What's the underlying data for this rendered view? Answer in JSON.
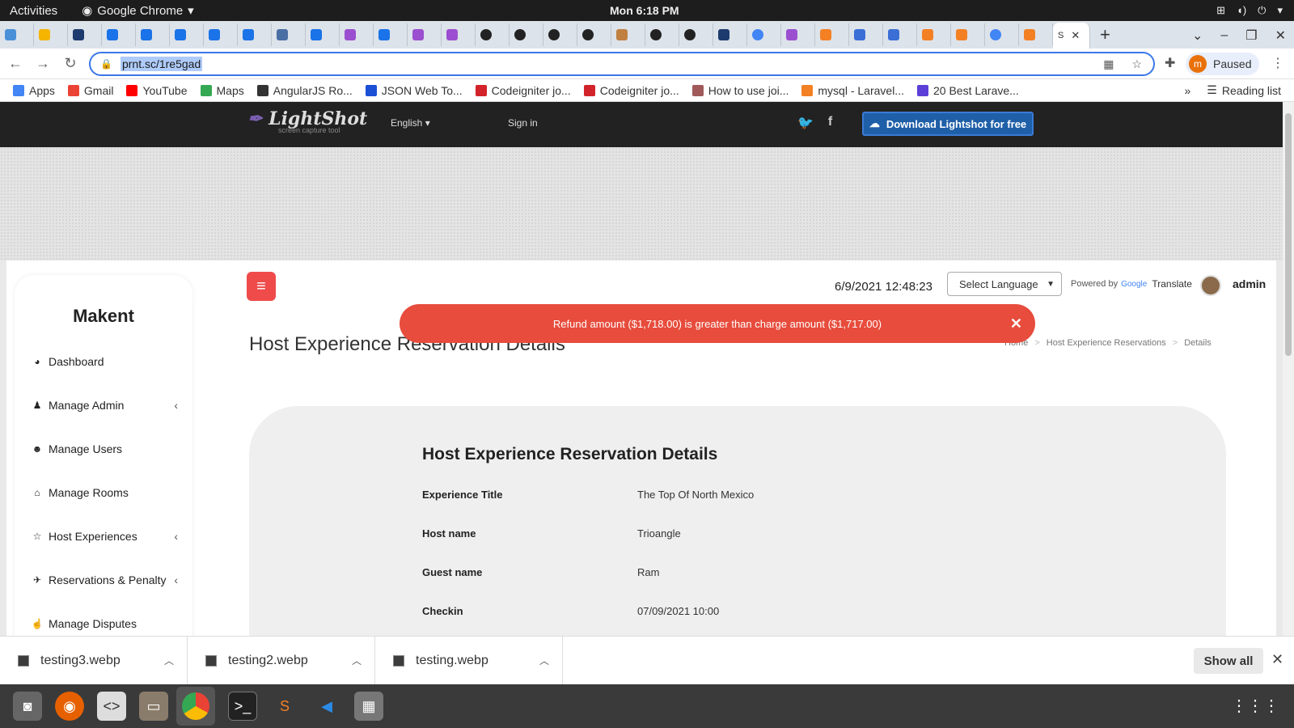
{
  "os": {
    "activities": "Activities",
    "app_name": "Google Chrome",
    "clock": "Mon  6:18 PM"
  },
  "browser": {
    "url": "prnt.sc/1re5gad",
    "profile_initial": "m",
    "profile_status": "Paused",
    "active_tab_label": "S"
  },
  "bookmarks": [
    {
      "label": "Apps",
      "color": "#4285f4"
    },
    {
      "label": "Gmail",
      "color": "#ea4335"
    },
    {
      "label": "YouTube",
      "color": "#ff0000"
    },
    {
      "label": "Maps",
      "color": "#34a853"
    },
    {
      "label": "AngularJS Ro...",
      "color": "#333333"
    },
    {
      "label": "JSON Web To...",
      "color": "#1a4fd6"
    },
    {
      "label": "Codeigniter jo...",
      "color": "#d2232a"
    },
    {
      "label": "Codeigniter jo...",
      "color": "#d2232a"
    },
    {
      "label": "How to use joi...",
      "color": "#a05a5a"
    },
    {
      "label": "mysql - Laravel...",
      "color": "#f48024"
    },
    {
      "label": "20 Best Larave...",
      "color": "#5b3fd6"
    }
  ],
  "reading_list": "Reading list",
  "lightshot": {
    "logo": "LightShot",
    "tagline": "screen capture tool",
    "language": "English",
    "sign_in": "Sign in",
    "download": "Download Lightshot for free"
  },
  "app": {
    "brand": "Makent",
    "datetime": "6/9/2021 12:48:23",
    "select_language": "Select Language",
    "powered_by": "Powered by",
    "google": "Google",
    "translate": "Translate",
    "user": "admin",
    "page_title": "Host Experience Reservation Details",
    "breadcrumb": [
      "Home",
      "Host Experience Reservations",
      "Details"
    ],
    "alert": "Refund amount ($1,718.00) is greater than charge amount ($1,717.00)",
    "menu": [
      {
        "label": "Dashboard",
        "icon": "dashboard-icon",
        "glyph": "◕",
        "chevron": false
      },
      {
        "label": "Manage Admin",
        "icon": "user-plus-icon",
        "glyph": "♟",
        "chevron": true
      },
      {
        "label": "Manage Users",
        "icon": "users-icon",
        "glyph": "☻",
        "chevron": false
      },
      {
        "label": "Manage Rooms",
        "icon": "home-icon",
        "glyph": "⌂",
        "chevron": false
      },
      {
        "label": "Host Experiences",
        "icon": "star-icon",
        "glyph": "☆",
        "chevron": true
      },
      {
        "label": "Reservations & Penalty",
        "icon": "plane-icon",
        "glyph": "✈",
        "chevron": true
      },
      {
        "label": "Manage Disputes",
        "icon": "hand-icon",
        "glyph": "☝",
        "chevron": false
      }
    ],
    "card_title": "Host Experience Reservation Details",
    "details": [
      {
        "key": "Experience Title",
        "value": "The Top Of North Mexico"
      },
      {
        "key": "Host name",
        "value": "Trioangle"
      },
      {
        "key": "Guest name",
        "value": "Ram"
      },
      {
        "key": "Checkin",
        "value": "07/09/2021 10:00"
      }
    ]
  },
  "downloads": {
    "items": [
      "testing3.webp",
      "testing2.webp",
      "testing.webp"
    ],
    "show_all": "Show all"
  }
}
